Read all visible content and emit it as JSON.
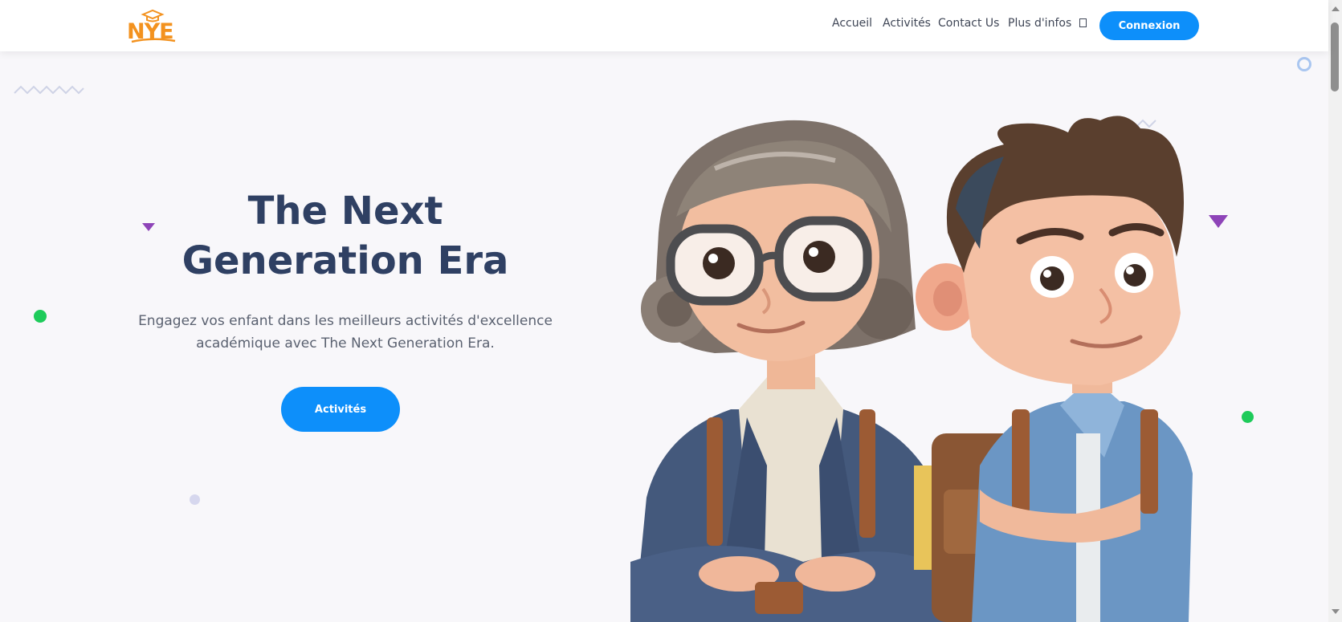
{
  "brand": {
    "logo_text": "NYE",
    "color": "#f3921f"
  },
  "nav": {
    "links": [
      "Accueil",
      "Activités",
      "Contact Us",
      "Plus d'infos"
    ],
    "more_icon": "square-icon",
    "login_label": "Connexion"
  },
  "hero": {
    "title_line1": "The Next",
    "title_line2": "Generation Era",
    "subtitle_line1": "Engagez vos enfant dans les meilleurs activités d'excellence",
    "subtitle_line2": "académique avec The Next Generation Era.",
    "cta_label": "Activités"
  },
  "colors": {
    "accent": "#0d8ffa",
    "title": "#2f4063",
    "background": "#f8f7fa",
    "deco_purple": "#8e44b8",
    "deco_green": "#1ecb5a"
  }
}
